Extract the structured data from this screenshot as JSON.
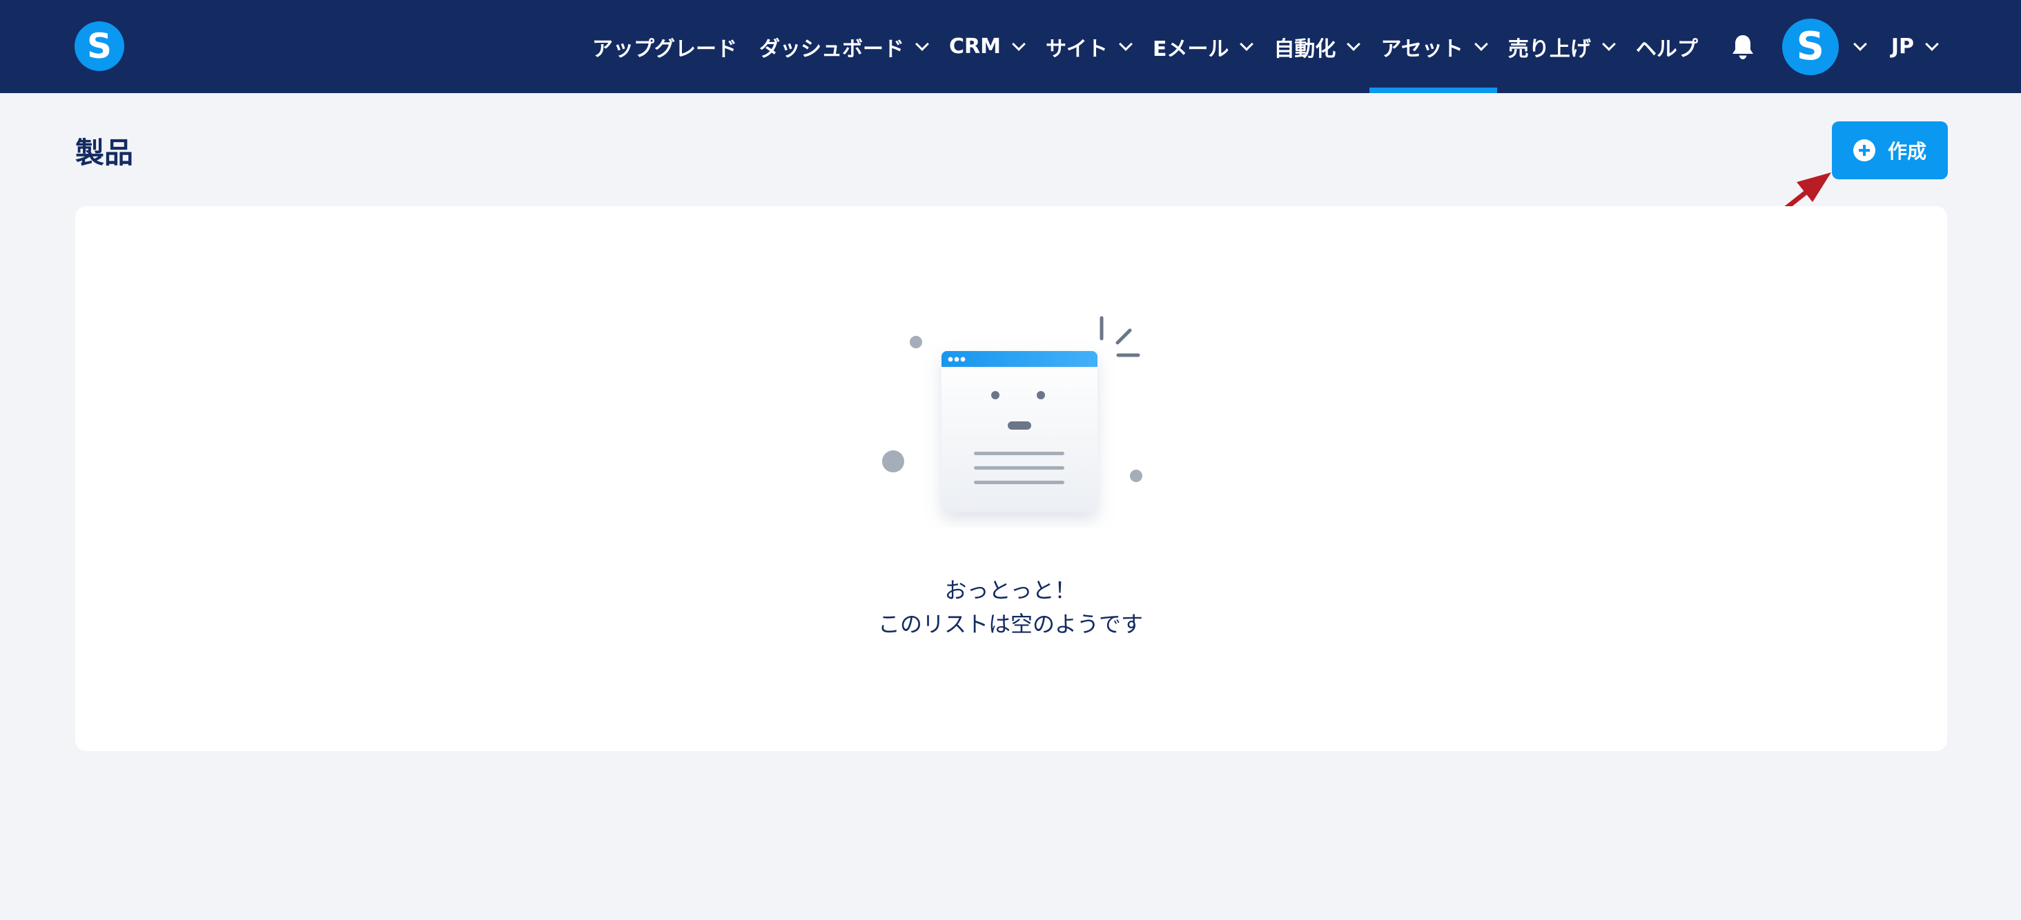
{
  "app": {
    "logo_letter": "S",
    "nav_bg": "#142b61",
    "accent": "#0b98f1"
  },
  "nav": {
    "items": [
      {
        "label": "アップグレード",
        "dropdown": false
      },
      {
        "label": "ダッシュボード",
        "dropdown": true
      },
      {
        "label": "CRM",
        "dropdown": true
      },
      {
        "label": "サイト",
        "dropdown": true
      },
      {
        "label": "Eメール",
        "dropdown": true
      },
      {
        "label": "自動化",
        "dropdown": true
      },
      {
        "label": "アセット",
        "dropdown": true,
        "active": true
      },
      {
        "label": "売り上げ",
        "dropdown": true
      },
      {
        "label": "ヘルプ",
        "dropdown": false
      }
    ],
    "notification_icon": "bell-icon",
    "avatar_letter": "S",
    "language": "JP"
  },
  "page": {
    "title": "製品",
    "create_label": "作成",
    "create_icon": "plus-circle-icon"
  },
  "empty_state": {
    "illustration_icon": "empty-list-illustration",
    "line1": "おっとっと！",
    "line2": "このリストは空のようです"
  },
  "annotation": {
    "arrow_color": "#b81c24"
  }
}
